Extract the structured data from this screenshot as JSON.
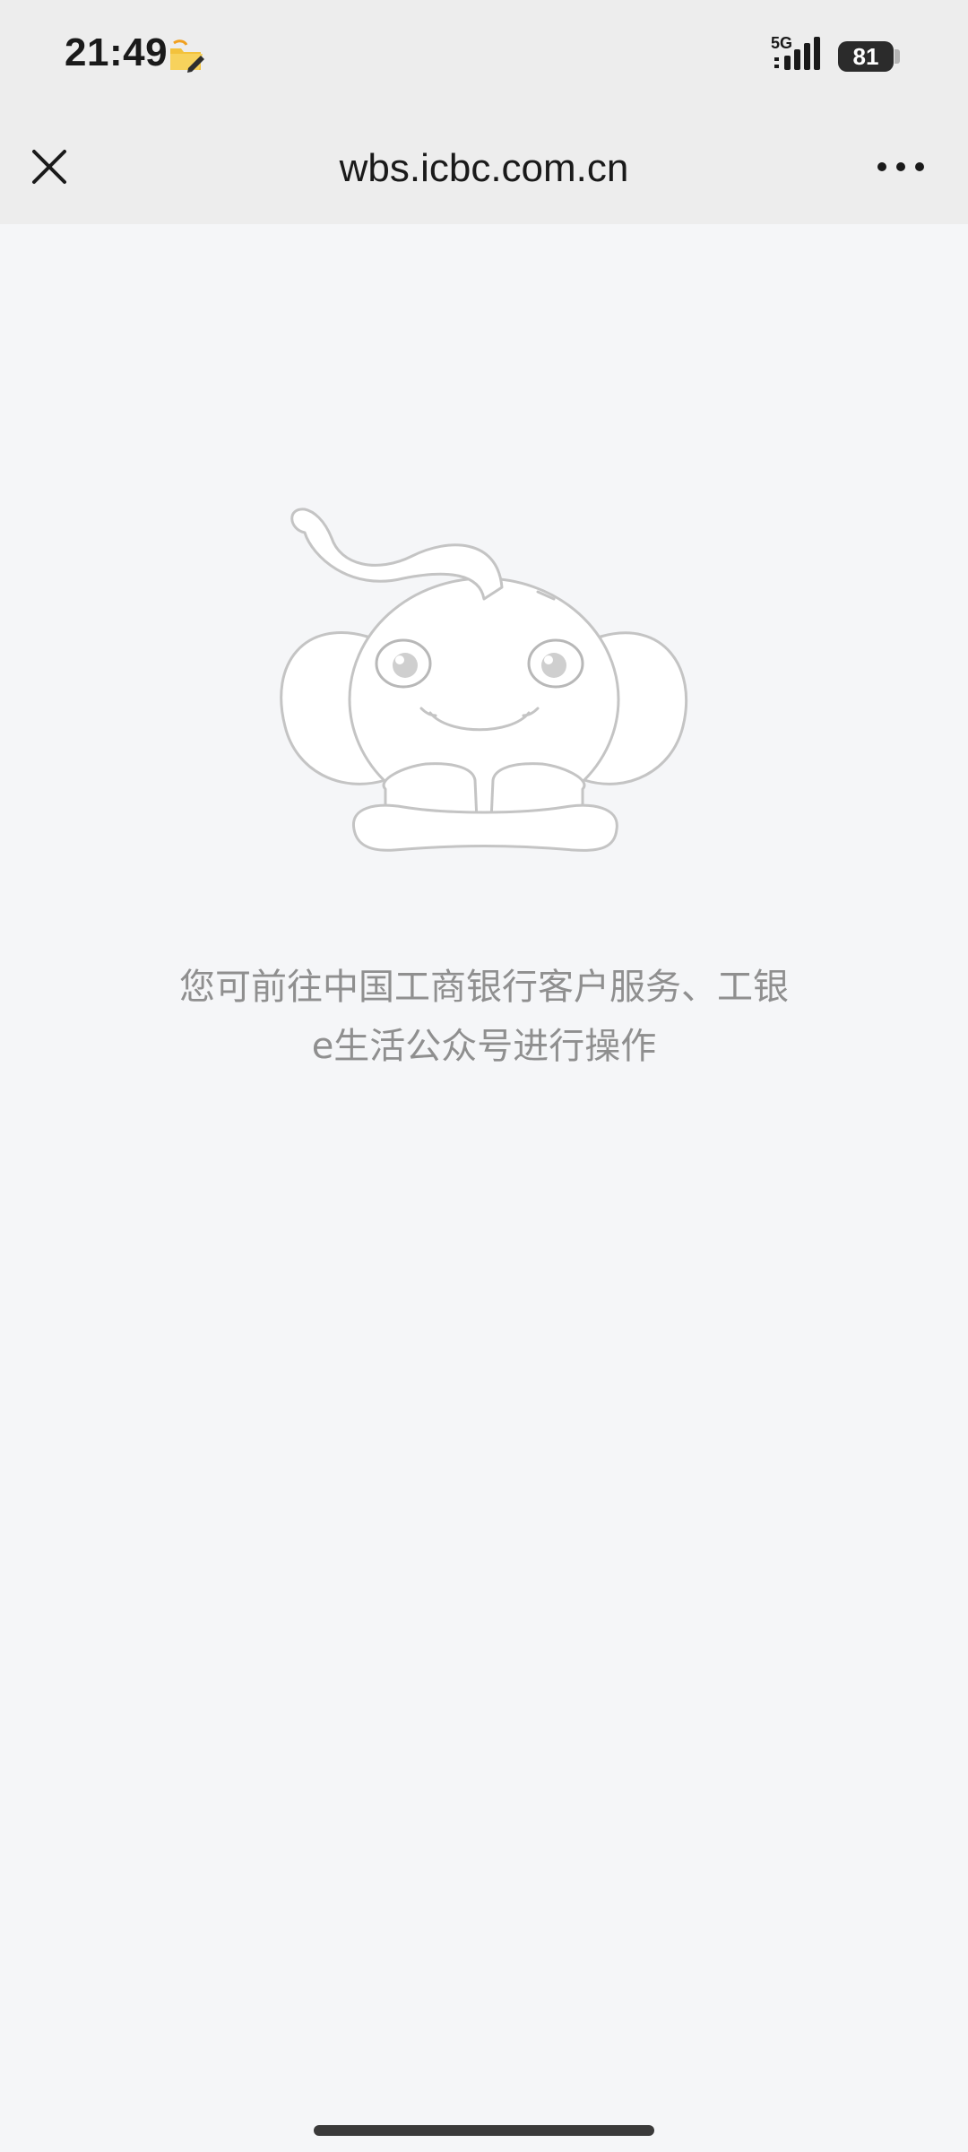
{
  "status_bar": {
    "time": "21:49",
    "network": "5G",
    "battery": "81",
    "icons": {
      "notification": "edit-folder-icon",
      "signal": "signal-bars-icon",
      "battery": "battery-icon"
    }
  },
  "nav": {
    "title": "wbs.icbc.com.cn",
    "icons": {
      "close": "close-icon",
      "more": "more-dots-icon"
    }
  },
  "content": {
    "illustration": "elephant-mascot-illustration",
    "message_line1": "您可前往中国工商银行客户服务、工银",
    "message_line2": "e生活公众号进行操作"
  },
  "colors": {
    "bar_background": "#ededed",
    "page_background": "#f5f6f8",
    "message_text": "#8f8f8f",
    "illustration_stroke": "#c4c4c4"
  }
}
